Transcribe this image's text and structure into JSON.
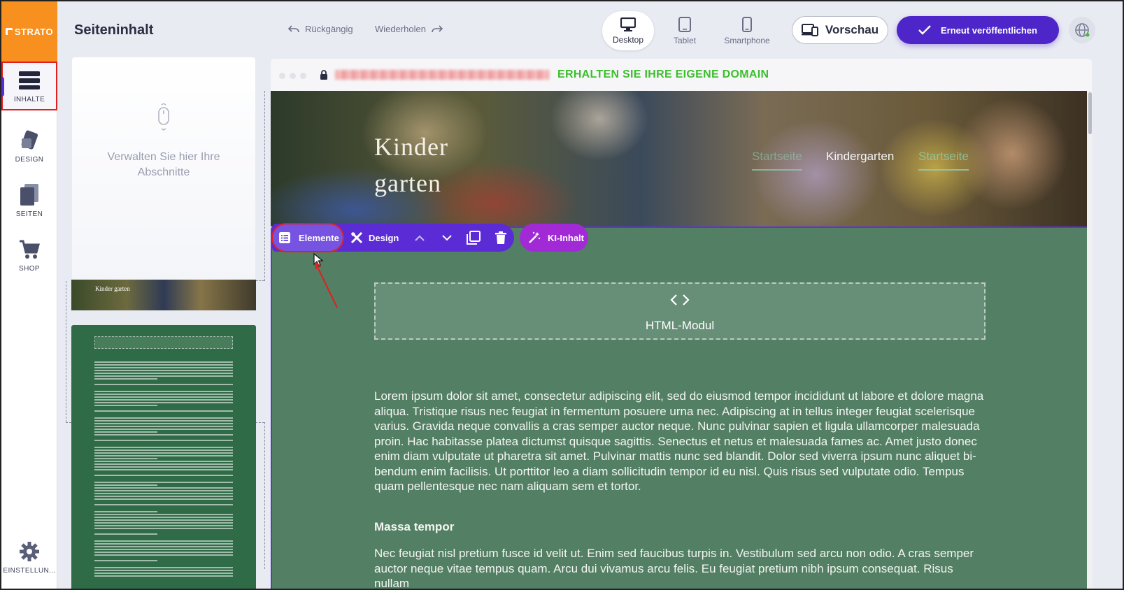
{
  "brand": {
    "logo_text": "STRATO"
  },
  "rail": [
    {
      "label": "INHALTE",
      "icon": "sections-icon",
      "active": true
    },
    {
      "label": "DESIGN",
      "icon": "palette-icon"
    },
    {
      "label": "SEITEN",
      "icon": "pages-icon"
    },
    {
      "label": "SHOP",
      "icon": "cart-icon"
    },
    {
      "label": "EINSTELLUN...",
      "icon": "gear-icon"
    }
  ],
  "header": {
    "title": "Seiteninhalt",
    "undo_label": "Rückgängig",
    "redo_label": "Wiederholen",
    "devices": [
      {
        "label": "Desktop",
        "selected": true
      },
      {
        "label": "Tablet"
      },
      {
        "label": "Smartphone"
      }
    ],
    "preview_label": "Vorschau",
    "publish_label": "Erneut veröffentlichen"
  },
  "sections_panel": {
    "hint": "Verwalten Sie hier Ihre Abschnitte",
    "thumb_header_text": "Kinder garten"
  },
  "browser": {
    "domain_cta": "ERHALTEN SIE IHRE EIGENE DOMAIN"
  },
  "site": {
    "hero_title_line1": "Kinder",
    "hero_title_line2": "garten",
    "nav": [
      "Startseite",
      "Kindergarten",
      "Startseite"
    ]
  },
  "section_toolbar": {
    "elements_label": "Elemente",
    "design_label": "Design",
    "ai_label": "KI-Inhalt"
  },
  "content": {
    "html_module_label": "HTML-Modul",
    "paragraph1": "Lorem ipsum dolor sit amet, consectetur adipiscing elit, sed do eiusmod tempor incididunt ut labore et dolore magna aliqua. Tristique risus nec feugiat in fermentum posuere urna nec. Adipiscing at in tellus integer feugiat scelerisque varius. Gravida neque convallis a cras semper auctor neque. Nunc pulvinar sapien et ligula ullamcorper malesuada proin. Hac habitasse platea dictumst quisque sagittis. Senectus et netus et malesuada fames ac. Amet justo donec enim diam vulputate ut pharetra sit amet. Pulvinar mattis nunc sed blandit. Dolor sed viverra ipsum nunc aliquet bi-bendum enim facilisis. Ut porttitor leo a diam sollicitudin tempor id eu nisl. Quis risus sed vulputate odio. Tempus quam pellentesque nec nam aliquam sem et tortor.",
    "heading2": "Massa tempor",
    "paragraph2": "Nec feugiat nisl pretium fusce id velit ut. Enim sed faucibus turpis in. Vestibulum sed arcu non odio. A cras semper auctor neque vitae tempus quam. Arcu dui vivamus arcu felis. Eu feugiat pretium nibh ipsum consequat. Risus nullam"
  },
  "colors": {
    "accent": "#4d25c8",
    "toolbar": "#5b2bd6",
    "ai_button": "#a22ad6",
    "content_bg": "#537f64",
    "logo_bg": "#f7901e",
    "domain_cta": "#3bbf2b",
    "highlight": "#e02020"
  }
}
